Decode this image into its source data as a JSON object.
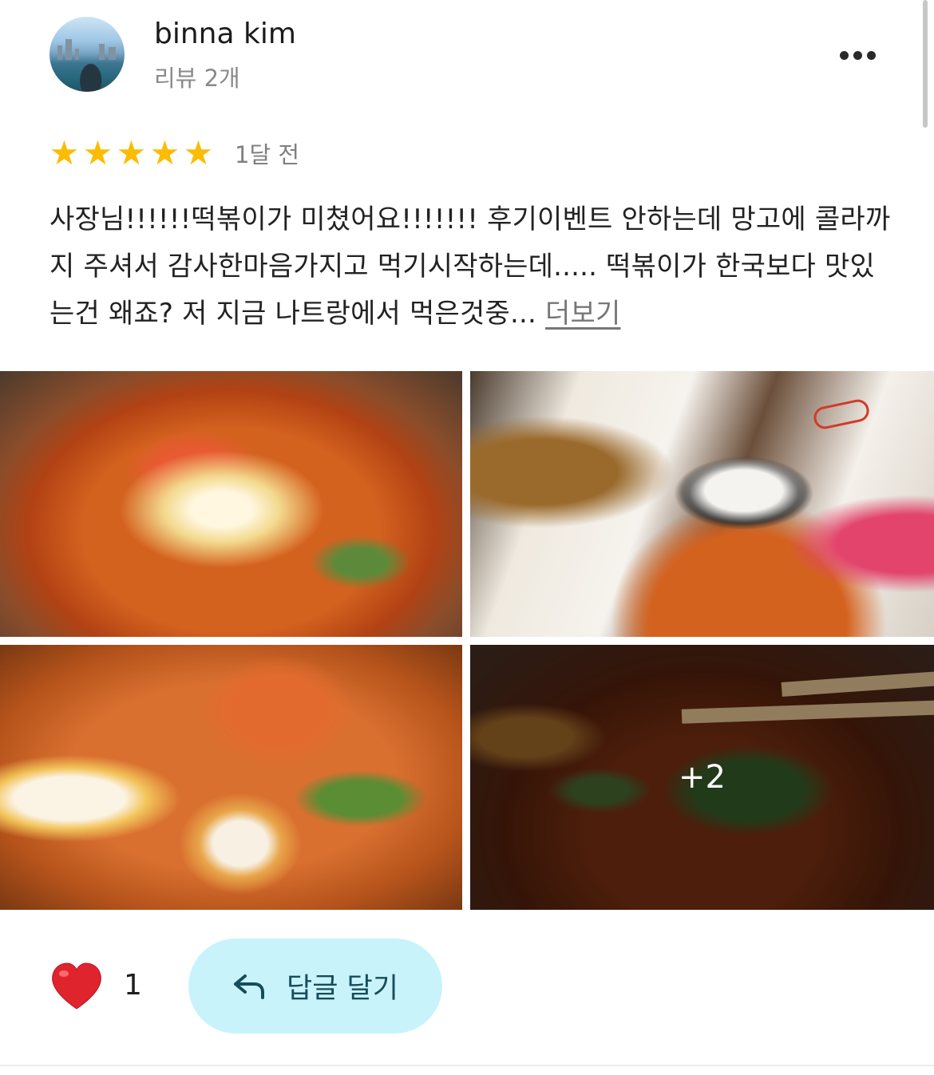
{
  "review": {
    "user": {
      "name": "binna kim",
      "review_count": "리뷰 2개"
    },
    "rating": {
      "stars": 5,
      "max": 5
    },
    "time_ago": "1달 전",
    "text": "사장님!!!!!!떡볶이가 미쳤어요!!!!!!! 후기이벤트 안하는데 망고에 콜라까지 주셔서 감사한마음가지고 먹기시작하는데..... 떡볶이가 한국보다 맛있는건 왜죠? 저 지금 나트랑에서 먹은것중...",
    "more_label": "더보기",
    "photos": {
      "items": [
        {
          "name": "tteokbokki-with-cheese"
        },
        {
          "name": "fried-chicken-and-rice-ball-set"
        },
        {
          "name": "tteokbokki-with-egg"
        },
        {
          "name": "tteokbokki-chopsticks"
        }
      ],
      "more_count_label": "+2"
    },
    "actions": {
      "like_count": "1",
      "reply_label": "답글 달기"
    }
  },
  "colors": {
    "star": "#fbbc05",
    "reply_button_bg": "#c9f3fb",
    "reply_button_text": "#164c5a",
    "heart": "#e0242e"
  },
  "icons": [
    "avatar",
    "more-options-icon",
    "star-icon",
    "heart-icon",
    "reply-arrow-icon"
  ]
}
